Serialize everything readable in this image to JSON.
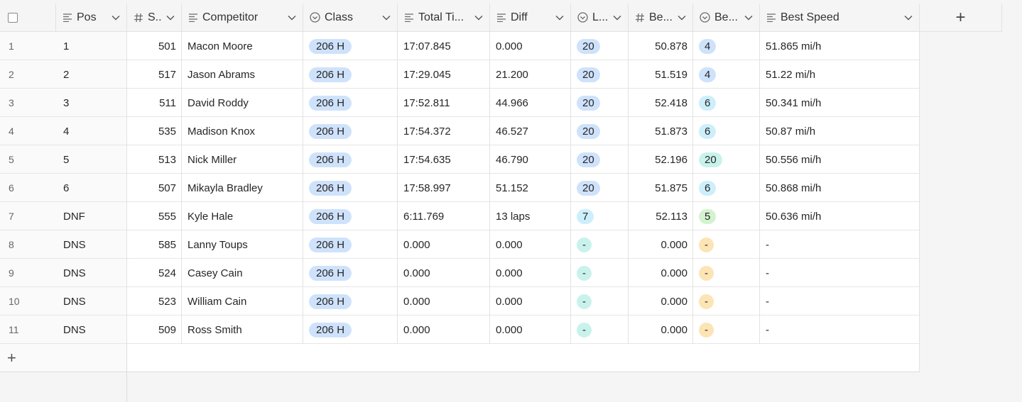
{
  "header": {
    "columns": [
      {
        "key": "pos",
        "label": "Pos",
        "icon": "text-icon"
      },
      {
        "key": "start",
        "label": "S..",
        "icon": "number-icon"
      },
      {
        "key": "competitor",
        "label": "Competitor",
        "icon": "text-icon"
      },
      {
        "key": "class",
        "label": "Class",
        "icon": "select-icon"
      },
      {
        "key": "total",
        "label": "Total Ti...",
        "icon": "text-icon"
      },
      {
        "key": "diff",
        "label": "Diff",
        "icon": "text-icon"
      },
      {
        "key": "laps",
        "label": "L...",
        "icon": "select-icon"
      },
      {
        "key": "bestlap",
        "label": "Be...",
        "icon": "number-icon"
      },
      {
        "key": "bestlapno",
        "label": "Be...",
        "icon": "select-icon"
      },
      {
        "key": "speed",
        "label": "Best Speed",
        "icon": "text-icon"
      }
    ],
    "add_column_label": "+"
  },
  "rows": [
    {
      "n": "1",
      "pos": "1",
      "start": "501",
      "competitor": "Macon Moore",
      "class": "206 H",
      "total": "17:07.845",
      "diff": "0.000",
      "laps": "20",
      "bestlap": "50.878",
      "bestlapno": "4",
      "bestlapno_color": "blue",
      "speed": "51.865 mi/h"
    },
    {
      "n": "2",
      "pos": "2",
      "start": "517",
      "competitor": "Jason Abrams",
      "class": "206 H",
      "total": "17:29.045",
      "diff": "21.200",
      "laps": "20",
      "bestlap": "51.519",
      "bestlapno": "4",
      "bestlapno_color": "blue",
      "speed": "51.22 mi/h"
    },
    {
      "n": "3",
      "pos": "3",
      "start": "511",
      "competitor": "David Roddy",
      "class": "206 H",
      "total": "17:52.811",
      "diff": "44.966",
      "laps": "20",
      "bestlap": "52.418",
      "bestlapno": "6",
      "bestlapno_color": "cyan",
      "speed": "50.341 mi/h"
    },
    {
      "n": "4",
      "pos": "4",
      "start": "535",
      "competitor": "Madison Knox",
      "class": "206 H",
      "total": "17:54.372",
      "diff": "46.527",
      "laps": "20",
      "bestlap": "51.873",
      "bestlapno": "6",
      "bestlapno_color": "cyan",
      "speed": "50.87 mi/h"
    },
    {
      "n": "5",
      "pos": "5",
      "start": "513",
      "competitor": "Nick Miller",
      "class": "206 H",
      "total": "17:54.635",
      "diff": "46.790",
      "laps": "20",
      "bestlap": "52.196",
      "bestlapno": "20",
      "bestlapno_color": "teal",
      "speed": "50.556 mi/h"
    },
    {
      "n": "6",
      "pos": "6",
      "start": "507",
      "competitor": "Mikayla Bradley",
      "class": "206 H",
      "total": "17:58.997",
      "diff": "51.152",
      "laps": "20",
      "bestlap": "51.875",
      "bestlapno": "6",
      "bestlapno_color": "cyan",
      "speed": "50.868 mi/h"
    },
    {
      "n": "7",
      "pos": "DNF",
      "start": "555",
      "competitor": "Kyle Hale",
      "class": "206 H",
      "total": "6:11.769",
      "diff": "13 laps",
      "laps": "7",
      "laps_color": "cyan",
      "bestlap": "52.113",
      "bestlapno": "5",
      "bestlapno_color": "green",
      "speed": "50.636 mi/h"
    },
    {
      "n": "8",
      "pos": "DNS",
      "start": "585",
      "competitor": "Lanny Toups",
      "class": "206 H",
      "total": "0.000",
      "diff": "0.000",
      "laps": "-",
      "laps_color": "teal",
      "bestlap": "0.000",
      "bestlapno": "-",
      "bestlapno_color": "orange",
      "speed": "-"
    },
    {
      "n": "9",
      "pos": "DNS",
      "start": "524",
      "competitor": "Casey Cain",
      "class": "206 H",
      "total": "0.000",
      "diff": "0.000",
      "laps": "-",
      "laps_color": "teal",
      "bestlap": "0.000",
      "bestlapno": "-",
      "bestlapno_color": "orange",
      "speed": "-"
    },
    {
      "n": "10",
      "pos": "DNS",
      "start": "523",
      "competitor": "William Cain",
      "class": "206 H",
      "total": "0.000",
      "diff": "0.000",
      "laps": "-",
      "laps_color": "teal",
      "bestlap": "0.000",
      "bestlapno": "-",
      "bestlapno_color": "orange",
      "speed": "-"
    },
    {
      "n": "11",
      "pos": "DNS",
      "start": "509",
      "competitor": "Ross Smith",
      "class": "206 H",
      "total": "0.000",
      "diff": "0.000",
      "laps": "-",
      "laps_color": "teal",
      "bestlap": "0.000",
      "bestlapno": "-",
      "bestlapno_color": "orange",
      "speed": "-"
    }
  ],
  "add_row_label": "+",
  "colors": {
    "blue": "#cfe2fb",
    "cyan": "#cdeffb",
    "teal": "#c9f2ec",
    "green": "#d3f3cf",
    "orange": "#fde4b5"
  }
}
